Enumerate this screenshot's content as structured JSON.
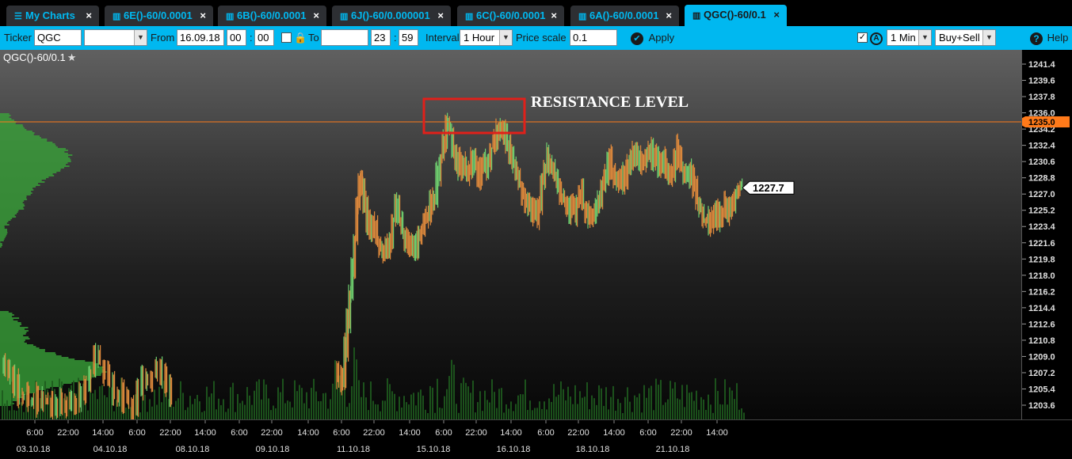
{
  "tabs": [
    {
      "label": "My Charts",
      "icon": "menu-icon",
      "active": false
    },
    {
      "label": "6E()-60/0.0001",
      "icon": "bar-chart-icon",
      "active": false
    },
    {
      "label": "6B()-60/0.0001",
      "icon": "bar-chart-icon",
      "active": false
    },
    {
      "label": "6J()-60/0.000001",
      "icon": "bar-chart-icon",
      "active": false
    },
    {
      "label": "6C()-60/0.0001",
      "icon": "bar-chart-icon",
      "active": false
    },
    {
      "label": "6A()-60/0.0001",
      "icon": "bar-chart-icon",
      "active": false
    },
    {
      "label": "QGC()-60/0.1",
      "icon": "bar-chart-icon",
      "active": true
    }
  ],
  "toolbar": {
    "ticker_label": "Ticker",
    "ticker_value": "QGC",
    "ticker_select_value": "",
    "from_label": "From",
    "from_date": "16.09.18",
    "from_hour": "00",
    "from_minute": "00",
    "to_label": "To",
    "to_date": "",
    "to_hour": "23",
    "to_minute": "59",
    "interval_label": "Interval",
    "interval_value": "1 Hour",
    "price_scale_label": "Price scale",
    "price_scale_value": "0.1",
    "apply_label": "Apply",
    "aggregation_value": "1 Min",
    "side_value": "Buy+Sell",
    "help_label": "Help"
  },
  "chart": {
    "title": "QGC()-60/0.1",
    "annotation": "RESISTANCE LEVEL",
    "resistance_level": "1235.0",
    "last_price": "1227.7",
    "colors": {
      "bar_up": "#6fd06f",
      "bar_down": "#e08a3c",
      "resistance_line": "#ff7a1a",
      "resistance_tag": "#ff7a1a",
      "annotation_box": "#e0201a",
      "volume": "#1e5a1e",
      "profile": "#3aa83a"
    }
  },
  "chart_data": {
    "type": "candlestick",
    "title": "QGC()-60/0.1",
    "y_ticks": [
      1241.4,
      1239.6,
      1237.8,
      1236.0,
      1234.2,
      1232.4,
      1230.6,
      1228.8,
      1227.0,
      1225.2,
      1223.4,
      1221.6,
      1219.8,
      1218.0,
      1216.2,
      1214.4,
      1212.6,
      1210.8,
      1209.0,
      1207.2,
      1205.4,
      1203.6
    ],
    "ylim": [
      1202.0,
      1242.8
    ],
    "x_time_labels": [
      "6:00",
      "22:00",
      "14:00",
      "6:00",
      "22:00",
      "14:00",
      "6:00",
      "22:00",
      "14:00",
      "6:00",
      "22:00",
      "14:00",
      "6:00",
      "22:00",
      "14:00",
      "6:00",
      "22:00",
      "14:00",
      "6:00",
      "22:00",
      "14:00"
    ],
    "x_date_labels": [
      "03.10.18",
      "04.10.18",
      "08.10.18",
      "09.10.18",
      "11.10.18",
      "15.10.18",
      "16.10.18",
      "18.10.18",
      "21.10.18"
    ],
    "horizontal_line": 1235.0,
    "last_value": 1227.7,
    "price_path": [
      [
        425,
        1207
      ],
      [
        430,
        1206
      ],
      [
        434,
        1210
      ],
      [
        437,
        1213
      ],
      [
        440,
        1216
      ],
      [
        443,
        1219
      ],
      [
        446,
        1222
      ],
      [
        449,
        1226
      ],
      [
        452,
        1229
      ],
      [
        455,
        1228
      ],
      [
        458,
        1226
      ],
      [
        462,
        1224
      ],
      [
        466,
        1223
      ],
      [
        470,
        1224
      ],
      [
        474,
        1222
      ],
      [
        478,
        1221
      ],
      [
        482,
        1220
      ],
      [
        486,
        1221
      ],
      [
        490,
        1222
      ],
      [
        494,
        1224
      ],
      [
        498,
        1226
      ],
      [
        502,
        1224
      ],
      [
        506,
        1223
      ],
      [
        510,
        1222
      ],
      [
        514,
        1221
      ],
      [
        518,
        1222
      ],
      [
        522,
        1221
      ],
      [
        526,
        1222
      ],
      [
        530,
        1223
      ],
      [
        534,
        1224
      ],
      [
        538,
        1225
      ],
      [
        542,
        1226
      ],
      [
        546,
        1227
      ],
      [
        550,
        1229
      ],
      [
        554,
        1231
      ],
      [
        558,
        1233
      ],
      [
        562,
        1235
      ],
      [
        566,
        1234
      ],
      [
        570,
        1232
      ],
      [
        574,
        1230
      ],
      [
        578,
        1231
      ],
      [
        582,
        1230
      ],
      [
        586,
        1229
      ],
      [
        590,
        1230
      ],
      [
        594,
        1231
      ],
      [
        598,
        1230
      ],
      [
        602,
        1229
      ],
      [
        606,
        1230
      ],
      [
        610,
        1231
      ],
      [
        614,
        1230
      ],
      [
        618,
        1232
      ],
      [
        622,
        1233
      ],
      [
        626,
        1234
      ],
      [
        630,
        1235
      ],
      [
        634,
        1234
      ],
      [
        638,
        1232
      ],
      [
        642,
        1231
      ],
      [
        646,
        1230
      ],
      [
        650,
        1229
      ],
      [
        654,
        1228
      ],
      [
        658,
        1227
      ],
      [
        662,
        1226
      ],
      [
        666,
        1226
      ],
      [
        670,
        1225
      ],
      [
        674,
        1224
      ],
      [
        678,
        1226
      ],
      [
        682,
        1228
      ],
      [
        686,
        1230
      ],
      [
        690,
        1231
      ],
      [
        694,
        1230
      ],
      [
        698,
        1229
      ],
      [
        702,
        1228
      ],
      [
        706,
        1227
      ],
      [
        710,
        1226
      ],
      [
        714,
        1225
      ],
      [
        718,
        1226
      ],
      [
        722,
        1225
      ],
      [
        726,
        1226
      ],
      [
        730,
        1227
      ],
      [
        734,
        1226
      ],
      [
        738,
        1225
      ],
      [
        742,
        1224
      ],
      [
        746,
        1225
      ],
      [
        750,
        1226
      ],
      [
        754,
        1227
      ],
      [
        758,
        1228
      ],
      [
        762,
        1229
      ],
      [
        766,
        1231
      ],
      [
        770,
        1229
      ],
      [
        774,
        1228
      ],
      [
        778,
        1229
      ],
      [
        782,
        1228
      ],
      [
        786,
        1229
      ],
      [
        790,
        1230
      ],
      [
        794,
        1231
      ],
      [
        798,
        1232
      ],
      [
        802,
        1231
      ],
      [
        806,
        1230
      ],
      [
        810,
        1231
      ],
      [
        814,
        1232
      ],
      [
        818,
        1231
      ],
      [
        822,
        1232
      ],
      [
        826,
        1231
      ],
      [
        830,
        1230
      ],
      [
        834,
        1231
      ],
      [
        838,
        1230
      ],
      [
        842,
        1229
      ],
      [
        846,
        1230
      ],
      [
        850,
        1231
      ],
      [
        854,
        1232
      ],
      [
        858,
        1230
      ],
      [
        862,
        1229
      ],
      [
        866,
        1230
      ],
      [
        870,
        1229
      ],
      [
        874,
        1228
      ],
      [
        878,
        1226
      ],
      [
        882,
        1225
      ],
      [
        886,
        1224
      ],
      [
        890,
        1224
      ],
      [
        894,
        1225
      ],
      [
        898,
        1224
      ],
      [
        902,
        1225
      ],
      [
        906,
        1224
      ],
      [
        910,
        1225
      ],
      [
        914,
        1226
      ],
      [
        918,
        1225
      ],
      [
        922,
        1226
      ],
      [
        926,
        1227
      ],
      [
        930,
        1227.5
      ],
      [
        934,
        1227.7
      ]
    ],
    "left_segment": [
      [
        4,
        1208
      ],
      [
        10,
        1207
      ],
      [
        16,
        1206
      ],
      [
        22,
        1205
      ],
      [
        28,
        1205
      ],
      [
        34,
        1204
      ],
      [
        40,
        1204
      ],
      [
        46,
        1205
      ],
      [
        52,
        1204
      ],
      [
        58,
        1204
      ],
      [
        64,
        1203
      ],
      [
        70,
        1204
      ],
      [
        76,
        1203
      ],
      [
        82,
        1204
      ],
      [
        88,
        1203
      ],
      [
        94,
        1204
      ],
      [
        100,
        1205
      ],
      [
        106,
        1206
      ],
      [
        112,
        1207
      ],
      [
        118,
        1209
      ],
      [
        124,
        1208
      ],
      [
        130,
        1207
      ],
      [
        136,
        1206
      ],
      [
        142,
        1205
      ],
      [
        148,
        1204
      ],
      [
        154,
        1205
      ],
      [
        160,
        1204
      ],
      [
        166,
        1203
      ],
      [
        172,
        1205
      ],
      [
        178,
        1207
      ],
      [
        184,
        1206
      ],
      [
        190,
        1207
      ],
      [
        196,
        1208
      ],
      [
        202,
        1207
      ],
      [
        208,
        1206
      ],
      [
        214,
        1204
      ]
    ]
  }
}
